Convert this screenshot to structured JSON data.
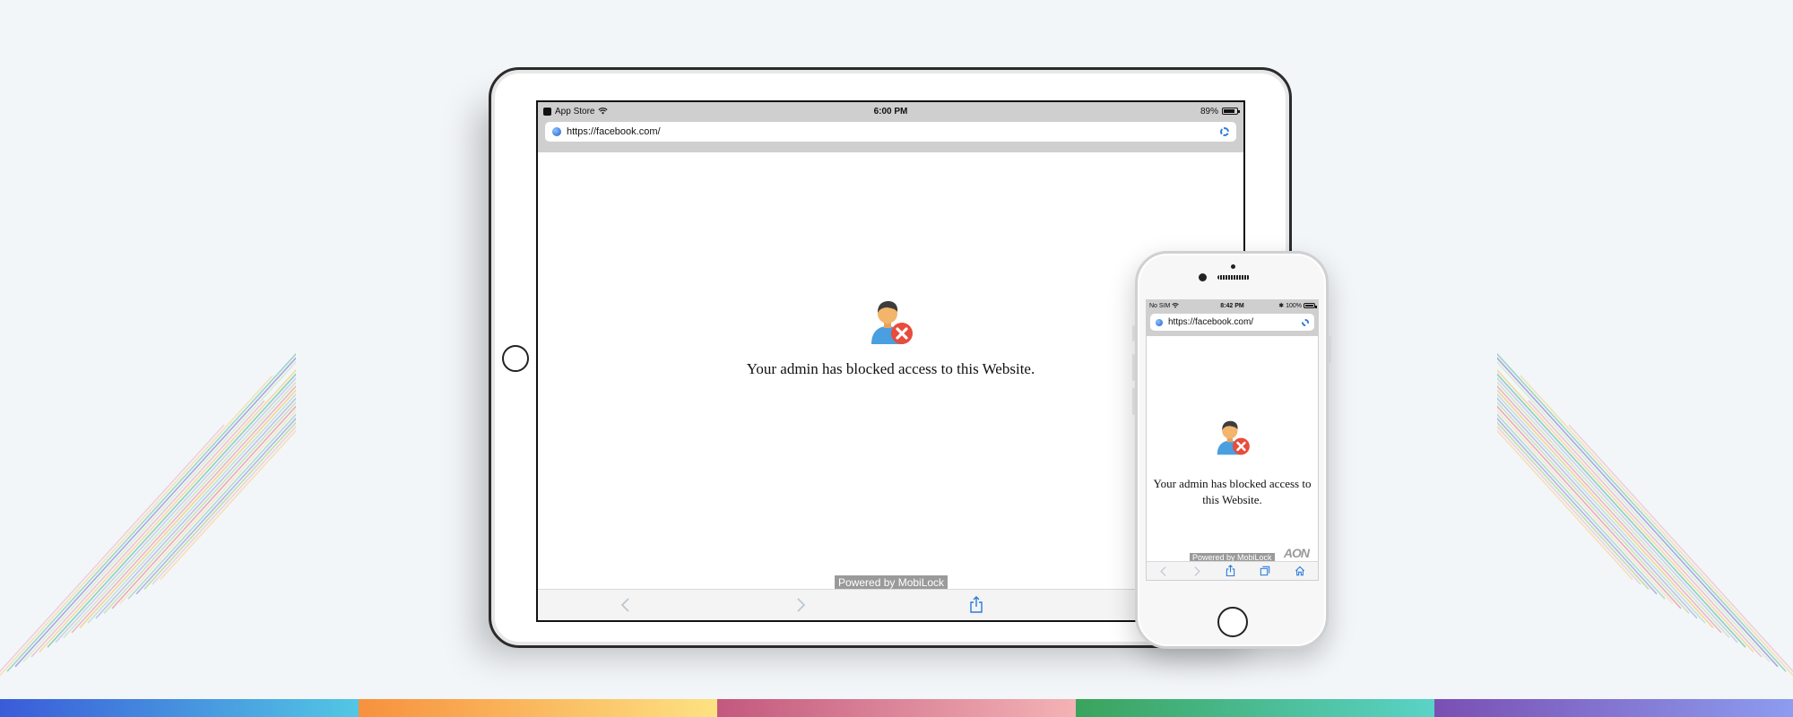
{
  "colors": {
    "background": "#f3f6f9",
    "bar_segments": [
      [
        "#3a5bd9",
        "#52c7e4"
      ],
      [
        "#f7913d",
        "#fde282"
      ],
      [
        "#c3587e",
        "#f4b3b5"
      ],
      [
        "#3aa35c",
        "#5ad3c7"
      ],
      [
        "#7a4fb3",
        "#8c9cf0"
      ]
    ],
    "stripe_palette": [
      "#e88aa6",
      "#f5c76a",
      "#5fc4a3",
      "#8e84d8",
      "#a8d98a"
    ],
    "link_blue": "#2a7bdc",
    "error_red": "#e74c3c"
  },
  "ipad": {
    "status": {
      "back_app": "App Store",
      "time": "6:00 PM",
      "battery_text": "89%",
      "battery_level": 0.89
    },
    "url": "https://facebook.com/",
    "blocked_message": "Your admin has blocked access to this Website.",
    "powered_by": "Powered by MobiLock",
    "toolbar": [
      "back-icon",
      "forward-icon",
      "share-icon",
      "tabs-icon"
    ]
  },
  "iphone": {
    "status": {
      "carrier": "No SIM",
      "time": "8:42 PM",
      "battery_text": "100%",
      "battery_level": 1.0
    },
    "url": "https://facebook.com/",
    "blocked_message": "Your admin has blocked access to this Website.",
    "powered_by": "Powered by MobiLock",
    "watermark": "AON",
    "toolbar": [
      "back-icon",
      "forward-icon",
      "share-icon",
      "tabs-icon",
      "home-icon"
    ]
  }
}
